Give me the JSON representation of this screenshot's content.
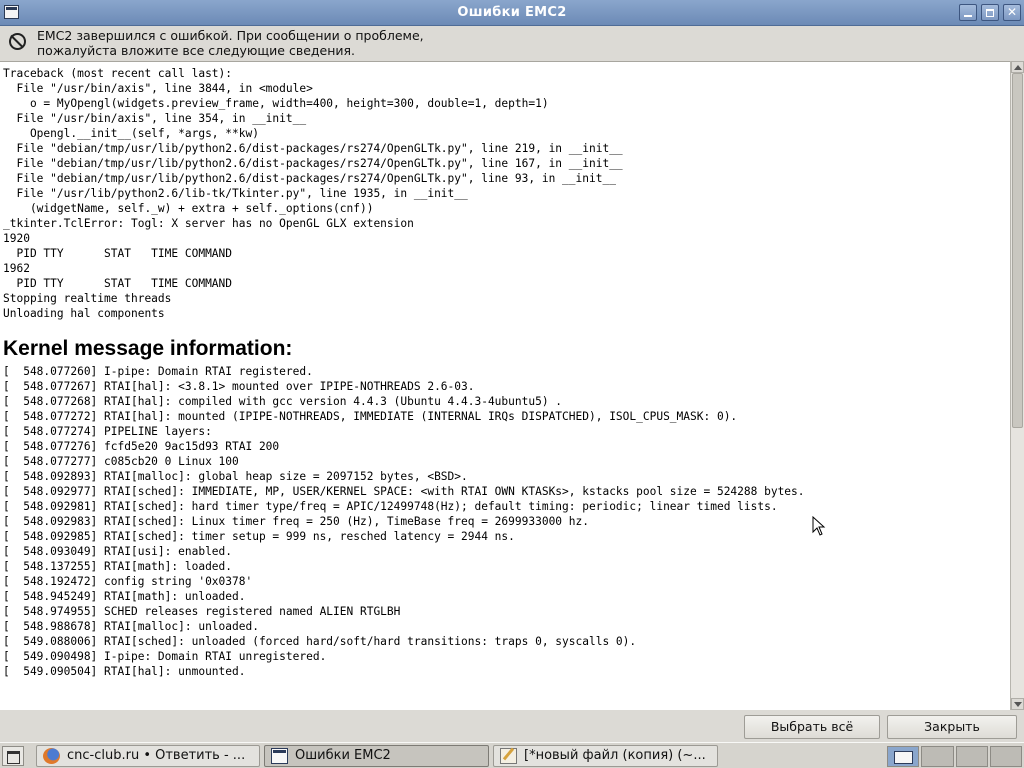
{
  "window": {
    "title": "Ошибки EMC2",
    "close_glyph": "✕"
  },
  "header": {
    "icon": "stop-icon",
    "message_line1": "EMC2 завершился с ошибкой. При сообщении о проблеме,",
    "message_line2": "пожалуйста вложите все следующие сведения."
  },
  "log": {
    "traceback": "Traceback (most recent call last):\n  File \"/usr/bin/axis\", line 3844, in <module>\n    o = MyOpengl(widgets.preview_frame, width=400, height=300, double=1, depth=1)\n  File \"/usr/bin/axis\", line 354, in __init__\n    Opengl.__init__(self, *args, **kw)\n  File \"debian/tmp/usr/lib/python2.6/dist-packages/rs274/OpenGLTk.py\", line 219, in __init__\n  File \"debian/tmp/usr/lib/python2.6/dist-packages/rs274/OpenGLTk.py\", line 167, in __init__\n  File \"debian/tmp/usr/lib/python2.6/dist-packages/rs274/OpenGLTk.py\", line 93, in __init__\n  File \"/usr/lib/python2.6/lib-tk/Tkinter.py\", line 1935, in __init__\n    (widgetName, self._w) + extra + self._options(cnf))\n_tkinter.TclError: Togl: X server has no OpenGL GLX extension\n1920\n  PID TTY      STAT   TIME COMMAND\n1962\n  PID TTY      STAT   TIME COMMAND\nStopping realtime threads\nUnloading hal components",
    "kernel_heading": "Kernel message information:",
    "kernel": "[  548.077260] I-pipe: Domain RTAI registered.\n[  548.077267] RTAI[hal]: <3.8.1> mounted over IPIPE-NOTHREADS 2.6-03.\n[  548.077268] RTAI[hal]: compiled with gcc version 4.4.3 (Ubuntu 4.4.3-4ubuntu5) .\n[  548.077272] RTAI[hal]: mounted (IPIPE-NOTHREADS, IMMEDIATE (INTERNAL IRQs DISPATCHED), ISOL_CPUS_MASK: 0).\n[  548.077274] PIPELINE layers:\n[  548.077276] fcfd5e20 9ac15d93 RTAI 200\n[  548.077277] c085cb20 0 Linux 100\n[  548.092893] RTAI[malloc]: global heap size = 2097152 bytes, <BSD>.\n[  548.092977] RTAI[sched]: IMMEDIATE, MP, USER/KERNEL SPACE: <with RTAI OWN KTASKs>, kstacks pool size = 524288 bytes.\n[  548.092981] RTAI[sched]: hard timer type/freq = APIC/12499748(Hz); default timing: periodic; linear timed lists.\n[  548.092983] RTAI[sched]: Linux timer freq = 250 (Hz), TimeBase freq = 2699933000 hz.\n[  548.092985] RTAI[sched]: timer setup = 999 ns, resched latency = 2944 ns.\n[  548.093049] RTAI[usi]: enabled.\n[  548.137255] RTAI[math]: loaded.\n[  548.192472] config string '0x0378'\n[  548.945249] RTAI[math]: unloaded.\n[  548.974955] SCHED releases registered named ALIEN RTGLBH\n[  548.988678] RTAI[malloc]: unloaded.\n[  549.088006] RTAI[sched]: unloaded (forced hard/soft/hard transitions: traps 0, syscalls 0).\n[  549.090498] I-pipe: Domain RTAI unregistered.\n[  549.090504] RTAI[hal]: unmounted."
  },
  "buttons": {
    "select_all": "Выбрать всё",
    "close": "Закрыть"
  },
  "taskbar": {
    "items": [
      {
        "label": "cnc-club.ru • Ответить - ...",
        "icon": "firefox-icon"
      },
      {
        "label": "Ошибки EMC2",
        "icon": "window-icon"
      },
      {
        "label": "[*новый файл (копия) (~...",
        "icon": "text-editor-icon"
      }
    ]
  },
  "colors": {
    "titlebar": "#7b97c1",
    "background": "#dcdad5",
    "textarea": "#ffffff"
  }
}
